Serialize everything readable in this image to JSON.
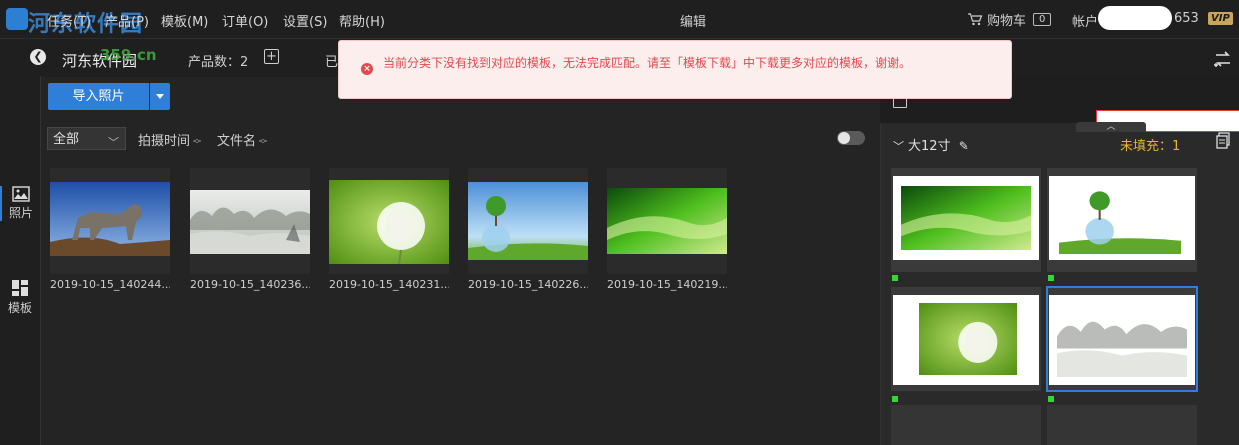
{
  "menubar": {
    "watermark": "河东软件园",
    "menus": [
      "任务(T)",
      "产品(P)",
      "模板(M)",
      "订单(O)",
      "设置(S)",
      "帮助(H)"
    ],
    "window_title": "编辑",
    "cart_label": "购物车",
    "cart_count": "0",
    "account_label": "帐户",
    "account_suffix": "653",
    "vip_badge": "VIP"
  },
  "subbar": {
    "shop_name": "河东软件园",
    "watermark_url": "359.cn",
    "product_count": "产品数：2",
    "selected_trunc": "已"
  },
  "sidenav": {
    "items": [
      {
        "label": "照片",
        "icon": "image-icon",
        "active": true
      },
      {
        "label": "模板",
        "icon": "grid-icon",
        "active": false
      }
    ]
  },
  "toolbar": {
    "import_label": "导入照片",
    "filter_value": "全部",
    "sort_time": "拍摄时间",
    "sort_name": "文件名"
  },
  "photos": [
    {
      "name": "2019-10-15_140244...",
      "kind": "wolf"
    },
    {
      "name": "2019-10-15_140236...",
      "kind": "ink-landscape"
    },
    {
      "name": "2019-10-15_140231...",
      "kind": "dandelion"
    },
    {
      "name": "2019-10-15_140226...",
      "kind": "tree-globe"
    },
    {
      "name": "2019-10-15_140219...",
      "kind": "green-wave"
    }
  ],
  "toast": {
    "type": "error",
    "message": "当前分类下没有找到对应的模板，无法完成匹配。请至「模板下载」中下载更多对应的模板，谢谢。"
  },
  "right_panel": {
    "size_label": "大12寸",
    "unfilled": "未填充：1",
    "templates": [
      {
        "kind": "green-wave",
        "selected": false
      },
      {
        "kind": "tree-globe",
        "selected": false
      },
      {
        "kind": "dandelion",
        "selected": false
      },
      {
        "kind": "ink-landscape",
        "selected": true
      }
    ]
  },
  "colors": {
    "accent": "#2f7ed8",
    "error": "#e2484f",
    "warning": "#e6b334",
    "fill_marker": "#33d633"
  }
}
